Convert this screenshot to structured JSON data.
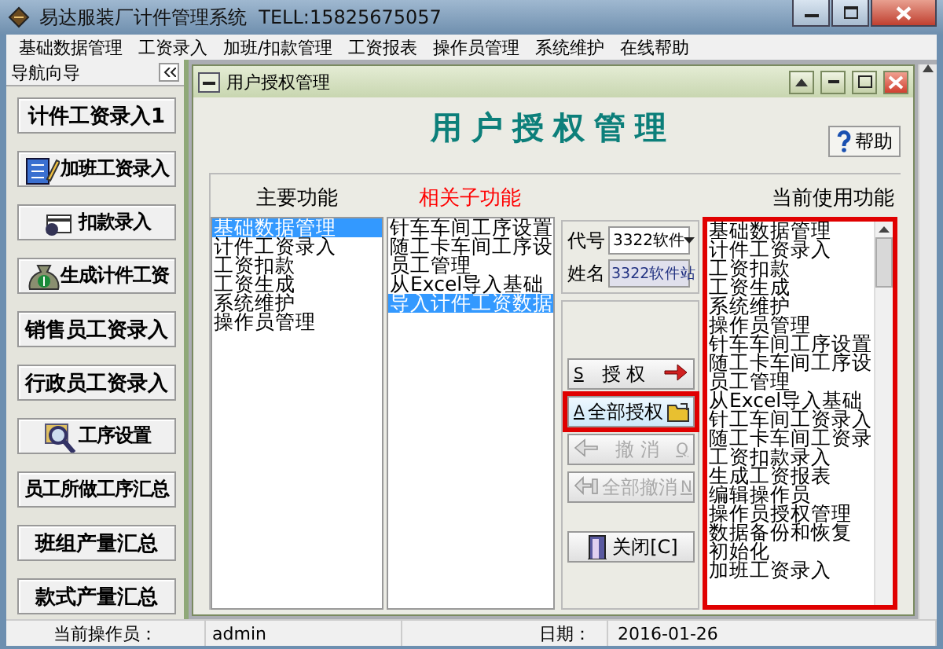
{
  "window": {
    "title": "易达服装厂计件管理系统  TELL:15825675057"
  },
  "menu": [
    "基础数据管理",
    "工资录入",
    "加班/扣款管理",
    "工资报表",
    "操作员管理",
    "系统维护",
    "在线帮助"
  ],
  "nav": {
    "title": "导航向导",
    "items": [
      {
        "label": "计件工资录入1",
        "kind": "plain"
      },
      {
        "label": "加班工资录入",
        "kind": "pencil"
      },
      {
        "label": "扣款录入",
        "kind": "card"
      },
      {
        "label": "生成计件工资",
        "kind": "moneybag"
      },
      {
        "label": "销售员工资录入",
        "kind": "plain"
      },
      {
        "label": "行政员工资录入",
        "kind": "plain"
      },
      {
        "label": "工序设置",
        "kind": "magnifier"
      },
      {
        "label": "员工所做工序汇总",
        "kind": "plain"
      },
      {
        "label": "班组产量汇总",
        "kind": "plain"
      },
      {
        "label": "款式产量汇总",
        "kind": "plain"
      }
    ]
  },
  "dialog": {
    "title": "用户授权管理",
    "heading": "用户授权管理",
    "help_button": "帮助",
    "main_functions": {
      "heading": "主要功能",
      "items": [
        {
          "label": "基础数据管理",
          "selected": true
        },
        {
          "label": "计件工资录入",
          "selected": false
        },
        {
          "label": "工资扣款",
          "selected": false
        },
        {
          "label": "工资生成",
          "selected": false
        },
        {
          "label": "系统维护",
          "selected": false
        },
        {
          "label": "操作员管理",
          "selected": false
        }
      ]
    },
    "sub_functions": {
      "heading": "相关子功能",
      "items": [
        {
          "label": "针车车间工序设置",
          "selected": false
        },
        {
          "label": "随工卡车间工序设",
          "selected": false
        },
        {
          "label": "员工管理",
          "selected": false
        },
        {
          "label": "从Excel导入基础",
          "selected": false
        },
        {
          "label": "导入计件工资数据",
          "selected": true
        }
      ]
    },
    "code": {
      "label": "代号",
      "value": "3322软件"
    },
    "name": {
      "label": "姓名",
      "value": "3322软件站"
    },
    "actions": [
      {
        "kind": "grant",
        "key": "S",
        "label": "授 权",
        "disabled": false,
        "highlighted": false
      },
      {
        "kind": "grant",
        "key": "A",
        "label": "全部授权",
        "disabled": false,
        "highlighted": true
      },
      {
        "kind": "revoke",
        "key": "Q",
        "label": "撤 消",
        "disabled": true,
        "highlighted": false
      },
      {
        "kind": "revoke",
        "key": "N",
        "label": "全部撤消",
        "disabled": true,
        "highlighted": false
      },
      {
        "kind": "close",
        "label": "关闭[C]",
        "disabled": false,
        "highlighted": false
      }
    ],
    "current_functions": {
      "heading": "当前使用功能",
      "highlighted": true,
      "items": [
        "基础数据管理",
        "计件工资录入",
        "工资扣款",
        "工资生成",
        "系统维护",
        "操作员管理",
        "针车车间工序设置",
        "随工卡车间工序设",
        "员工管理",
        "从Excel导入基础",
        "针工车间工资录入",
        "随工卡车间工资录",
        "工资扣款录入",
        "生成工资报表",
        "编辑操作员",
        "操作员授权管理",
        "数据备份和恢复",
        "初始化",
        "加班工资录入"
      ]
    }
  },
  "status_bar": [
    {
      "label": "当前操作员：",
      "value": "admin"
    },
    {
      "label": "日期：",
      "value": "2016-01-26"
    }
  ]
}
